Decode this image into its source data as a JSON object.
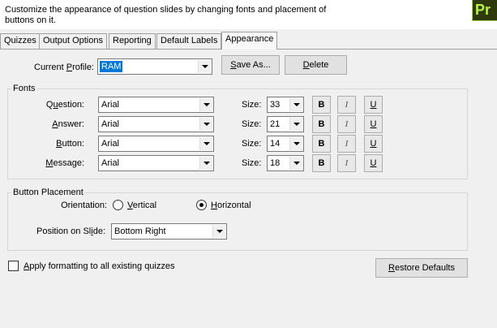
{
  "header": {
    "description": "Customize the appearance of question slides by changing fonts and placement of buttons on it.",
    "logo_text": "Pr"
  },
  "tabs": [
    {
      "label": "Quizzes",
      "active": false
    },
    {
      "label": "Output Options",
      "active": false
    },
    {
      "label": "Reporting",
      "active": false
    },
    {
      "label": "Default Labels",
      "active": false
    },
    {
      "label": "Appearance",
      "active": true
    }
  ],
  "profile": {
    "label_pre": "Current ",
    "label_key": "P",
    "label_post": "rofile:",
    "value": "RAM",
    "save_as_key": "S",
    "save_as_rest": "ave As...",
    "delete_key": "D",
    "delete_rest": "elete"
  },
  "fonts": {
    "title": "Fonts",
    "size_label": "Size:",
    "bold_label": "B",
    "italic_label": "I",
    "underline_label": "U",
    "rows": [
      {
        "label_pre": "Q",
        "label_key": "u",
        "label_post": "estion:",
        "font": "Arial",
        "size": "33"
      },
      {
        "label_pre": "",
        "label_key": "A",
        "label_post": "nswer:",
        "font": "Arial",
        "size": "21"
      },
      {
        "label_pre": "",
        "label_key": "B",
        "label_post": "utton:",
        "font": "Arial",
        "size": "14"
      },
      {
        "label_pre": "",
        "label_key": "M",
        "label_post": "essage:",
        "font": "Arial",
        "size": "18"
      }
    ]
  },
  "placement": {
    "title": "Button Placement",
    "orientation_label": "Orientation:",
    "vertical_key": "V",
    "vertical_rest": "ertical",
    "horizontal_key": "H",
    "horizontal_rest": "orizontal",
    "selected": "Horizontal",
    "position_pre": "Position on Sl",
    "position_key": "i",
    "position_post": "de:",
    "position_value": "Bottom Right"
  },
  "apply_all": {
    "key": "A",
    "rest": "pply formatting to all existing quizzes",
    "checked": false
  },
  "restore": {
    "key": "R",
    "rest": "estore Defaults"
  }
}
